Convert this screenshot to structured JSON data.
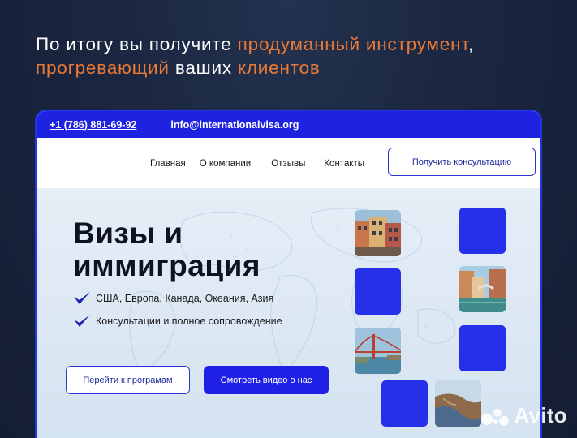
{
  "headline": {
    "parts": [
      {
        "text": "По итогу вы получите ",
        "accent": false
      },
      {
        "text": "продуманный инструмент",
        "accent": true
      },
      {
        "text": ", ",
        "accent": false
      },
      {
        "text": "прогревающий",
        "accent": true
      },
      {
        "text": " ваших ",
        "accent": false
      },
      {
        "text": "клиентов",
        "accent": true
      }
    ]
  },
  "topbar": {
    "phone": "+1 (786) 881-69-92",
    "email": "info@internationalvisa.org"
  },
  "nav": {
    "items": [
      "Главная",
      "О компании",
      "Отзывы",
      "Контакты"
    ],
    "cta": "Получить консультацию"
  },
  "hero": {
    "title": "Визы и иммиграция",
    "bullets": [
      "США, Европа, Канада, Океания, Азия",
      "Консультации и полное сопровождение"
    ],
    "btn_programs": "Перейти к програмам",
    "btn_video": "Смотреть видео о нас"
  },
  "watermark": "Avito",
  "colors": {
    "background": "#1b2640",
    "accent": "#ea7a35",
    "brand_blue": "#1d23e0"
  }
}
